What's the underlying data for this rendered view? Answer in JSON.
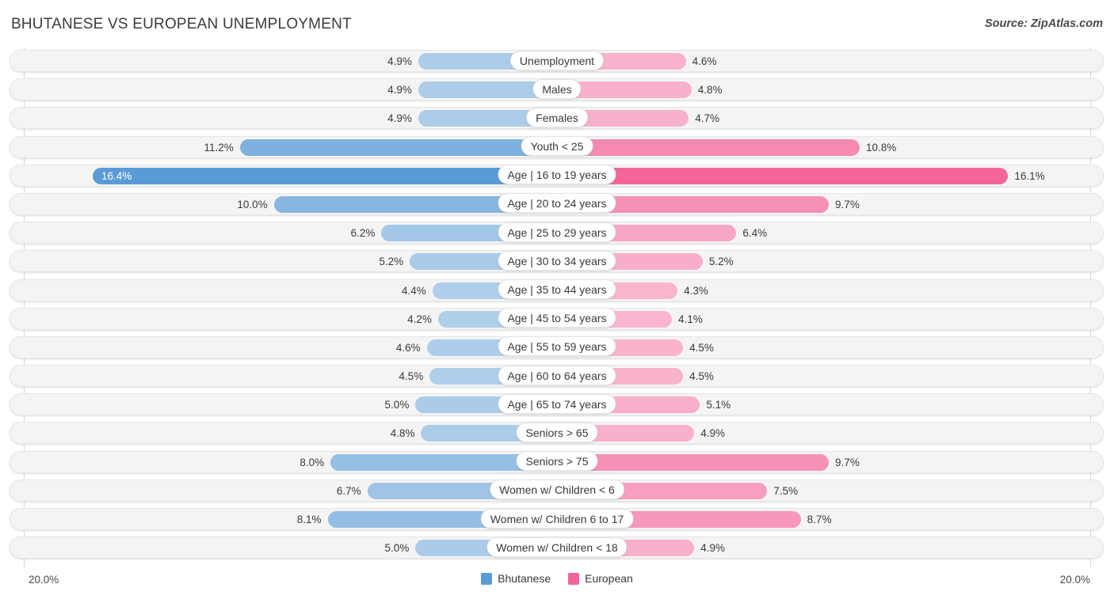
{
  "header": {
    "title": "BHUTANESE VS EUROPEAN UNEMPLOYMENT",
    "source": "Source: ZipAtlas.com"
  },
  "footer": {
    "axis_left": "20.0%",
    "axis_right": "20.0%",
    "legend": [
      {
        "label": "Bhutanese",
        "color": "#5b9bd5",
        "icon": "legend-swatch-blue"
      },
      {
        "label": "European",
        "color": "#f2649a",
        "icon": "legend-swatch-pink"
      }
    ]
  },
  "chart_data": {
    "type": "bar",
    "title": "BHUTANESE VS EUROPEAN UNEMPLOYMENT",
    "orientation": "horizontal-diverging",
    "xlabel": "",
    "ylabel": "",
    "xlim": [
      0,
      20.0
    ],
    "axis_max": 20.0,
    "grid": true,
    "legend_position": "bottom-center",
    "categories": [
      "Unemployment",
      "Males",
      "Females",
      "Youth < 25",
      "Age | 16 to 19 years",
      "Age | 20 to 24 years",
      "Age | 25 to 29 years",
      "Age | 30 to 34 years",
      "Age | 35 to 44 years",
      "Age | 45 to 54 years",
      "Age | 55 to 59 years",
      "Age | 60 to 64 years",
      "Age | 65 to 74 years",
      "Seniors > 65",
      "Seniors > 75",
      "Women w/ Children < 6",
      "Women w/ Children 6 to 17",
      "Women w/ Children < 18"
    ],
    "series": [
      {
        "name": "Bhutanese",
        "side": "left",
        "color": "#5b9bd5",
        "values": [
          4.9,
          4.9,
          4.9,
          11.2,
          16.4,
          10.0,
          6.2,
          5.2,
          4.4,
          4.2,
          4.6,
          4.5,
          5.0,
          4.8,
          8.0,
          6.7,
          8.1,
          5.0
        ],
        "labels": [
          "4.9%",
          "4.9%",
          "4.9%",
          "11.2%",
          "16.4%",
          "10.0%",
          "6.2%",
          "5.2%",
          "4.4%",
          "4.2%",
          "4.6%",
          "4.5%",
          "5.0%",
          "4.8%",
          "8.0%",
          "6.7%",
          "8.1%",
          "5.0%"
        ]
      },
      {
        "name": "European",
        "side": "right",
        "color": "#f2649a",
        "values": [
          4.6,
          4.8,
          4.7,
          10.8,
          16.1,
          9.7,
          6.4,
          5.2,
          4.3,
          4.1,
          4.5,
          4.5,
          5.1,
          4.9,
          9.7,
          7.5,
          8.7,
          4.9
        ],
        "labels": [
          "4.6%",
          "4.8%",
          "4.7%",
          "10.8%",
          "16.1%",
          "9.7%",
          "6.4%",
          "5.2%",
          "4.3%",
          "4.1%",
          "4.5%",
          "4.5%",
          "5.1%",
          "4.9%",
          "9.7%",
          "7.5%",
          "8.7%",
          "4.9%"
        ]
      }
    ]
  }
}
